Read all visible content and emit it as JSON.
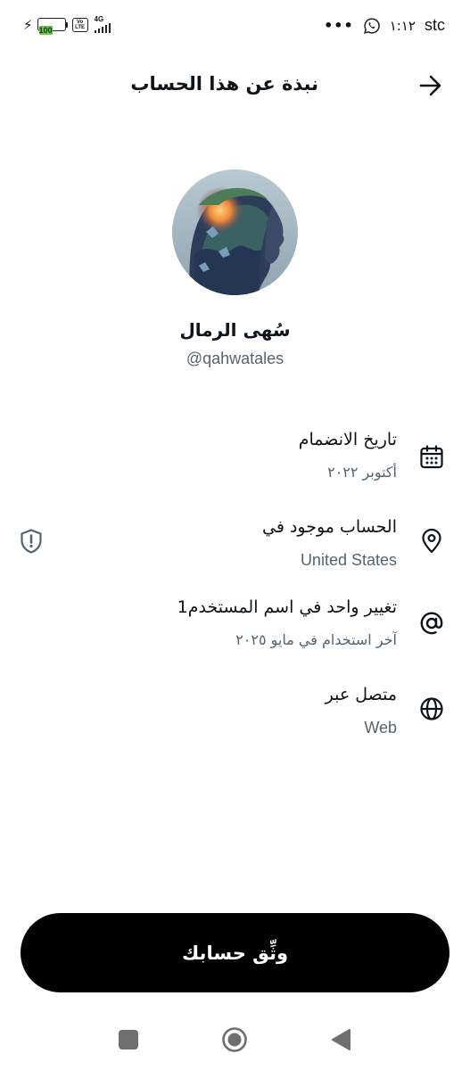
{
  "status_bar": {
    "battery": "100",
    "volte_label": "Vo LTE",
    "network": "4G",
    "dots": "•••",
    "time": "١:١٢",
    "carrier": "stc"
  },
  "header": {
    "title": "نبذة عن هذا الحساب"
  },
  "profile": {
    "display_name": "سُهى الرمال",
    "username": "@qahwatales"
  },
  "rows": [
    {
      "icon": "calendar-icon",
      "title": "تاريخ الانضمام",
      "subtitle": "أكتوبر ٢٠٢٢"
    },
    {
      "icon": "location-pin-icon",
      "title": "الحساب موجود في",
      "subtitle": "United States",
      "side_icon": "shield-info-icon"
    },
    {
      "icon": "at-sign-icon",
      "title": "تغيير واحد في اسم المستخدم1",
      "subtitle": "آخر استخدام في مايو ٢٠٢٥"
    },
    {
      "icon": "globe-icon",
      "title": "متصل عبر",
      "subtitle": "Web"
    }
  ],
  "cta": {
    "label": "وثِّق حسابك"
  },
  "colors": {
    "primary_text": "#0f1419",
    "secondary_text": "#536471",
    "button_bg": "#000000",
    "button_text": "#ffffff"
  }
}
